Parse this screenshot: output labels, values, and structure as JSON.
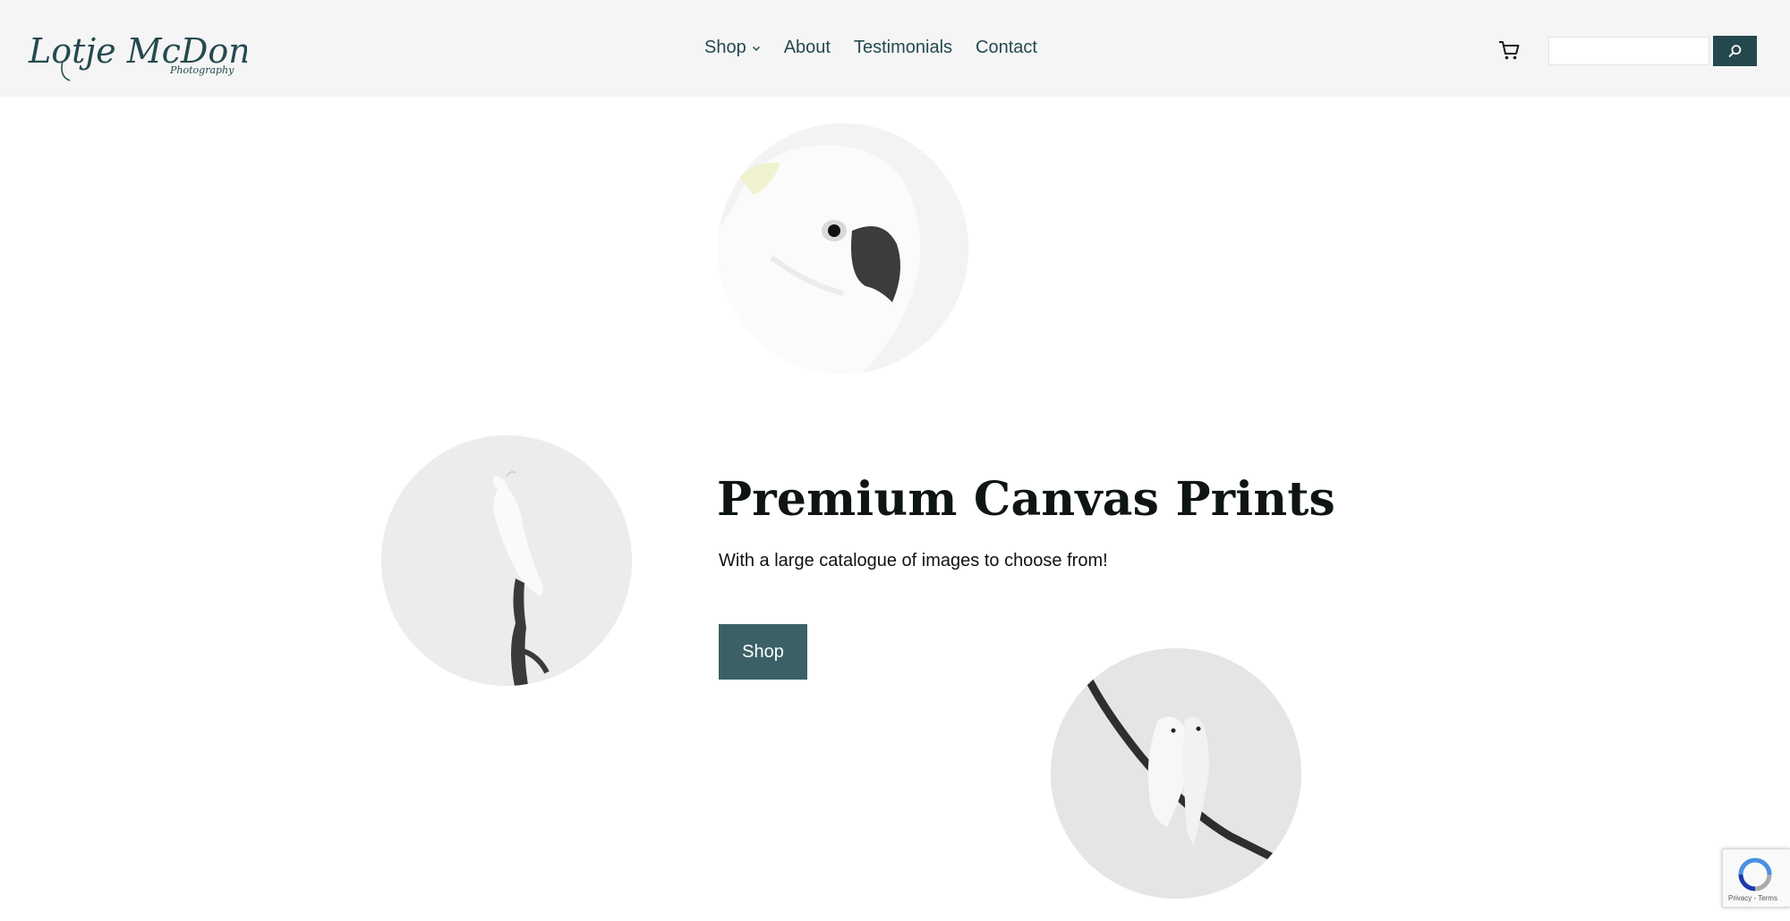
{
  "brand": {
    "logo_text": "Lotje McDonald",
    "logo_subtext": "Photography",
    "color": "#244a4f"
  },
  "nav": {
    "items": [
      {
        "label": "Shop",
        "has_dropdown": true
      },
      {
        "label": "About"
      },
      {
        "label": "Testimonials"
      },
      {
        "label": "Contact"
      }
    ]
  },
  "header_tools": {
    "cart_icon": "shopping-cart-icon",
    "search_placeholder": "",
    "search_icon": "search-icon",
    "search_button_color": "#24484d"
  },
  "hero": {
    "title": "Premium Canvas Prints",
    "subtitle": "With a large catalogue of images to choose from!",
    "button_label": "Shop",
    "button_color": "#3b6166"
  },
  "images": [
    {
      "subject": "cockatoo-head"
    },
    {
      "subject": "cockatoo-on-branch"
    },
    {
      "subject": "two-cockatoos-on-branch"
    }
  ],
  "recaptcha": {
    "links": "Privacy - Terms"
  }
}
